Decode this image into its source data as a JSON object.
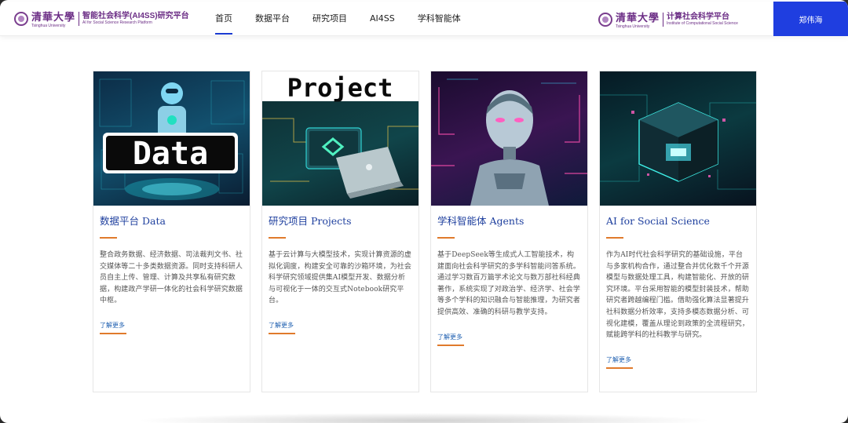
{
  "header": {
    "left_logo_cn": "清華大學",
    "left_logo_en": "Tsinghua University",
    "platform_title": "智能社会科学(AI4SS)研究平台",
    "platform_subtitle": "AI for Social Science Research Platform",
    "right_logo_cn": "清華大學",
    "right_logo_en": "Tsinghua University",
    "right_title": "计算社会科学平台",
    "right_subtitle": "Institute of Computational Social Science",
    "user_name": "郑伟海"
  },
  "nav": {
    "items": [
      {
        "label": "首页",
        "active": true
      },
      {
        "label": "数据平台",
        "active": false
      },
      {
        "label": "研究项目",
        "active": false
      },
      {
        "label": "AI4SS",
        "active": false
      },
      {
        "label": "学科智能体",
        "active": false
      }
    ]
  },
  "cards": [
    {
      "image_word": "Data",
      "title": "数据平台 Data",
      "desc": "整合政务数据、经济数据、司法裁判文书、社交媒体等二十多类数据资源。同时支持科研人员自主上传、管理、计算及共享私有研究数据，构建政产学研一体化的社会科学研究数据中枢。",
      "link": "了解更多"
    },
    {
      "image_word": "Project",
      "title": "研究项目 Projects",
      "desc": "基于云计算与大模型技术，实现计算资源的虚拟化调度，构建安全可靠的沙箱环境，为社会科学研究领域提供集AI模型开发、数据分析与可视化于一体的交互式Notebook研究平台。",
      "link": "了解更多"
    },
    {
      "image_word": "",
      "title": "学科智能体 Agents",
      "desc": "基于DeepSeek等生成式人工智能技术，构建面向社会科学研究的多学科智能问答系统。通过学习数百万篇学术论文与数万部社科经典著作，系统实现了对政治学、经济学、社会学等多个学科的知识融合与智能推理，为研究者提供高效、准确的科研与教学支持。",
      "link": "了解更多"
    },
    {
      "image_word": "",
      "title": "AI for Social Science",
      "desc": "作为AI时代社会科学研究的基础设施，平台与多家机构合作，通过整合并优化数千个开源模型与数据处理工具，构建智能化、开放的研究环境。平台采用智能的模型封装技术，帮助研究者跨越编程门槛。借助强化算法显著提升社科数据分析效率，支持多模态数据分析、可视化建模，覆盖从理论到政策的全流程研究，赋能跨学科的社科教学与研究。",
      "link": "了解更多"
    }
  ]
}
